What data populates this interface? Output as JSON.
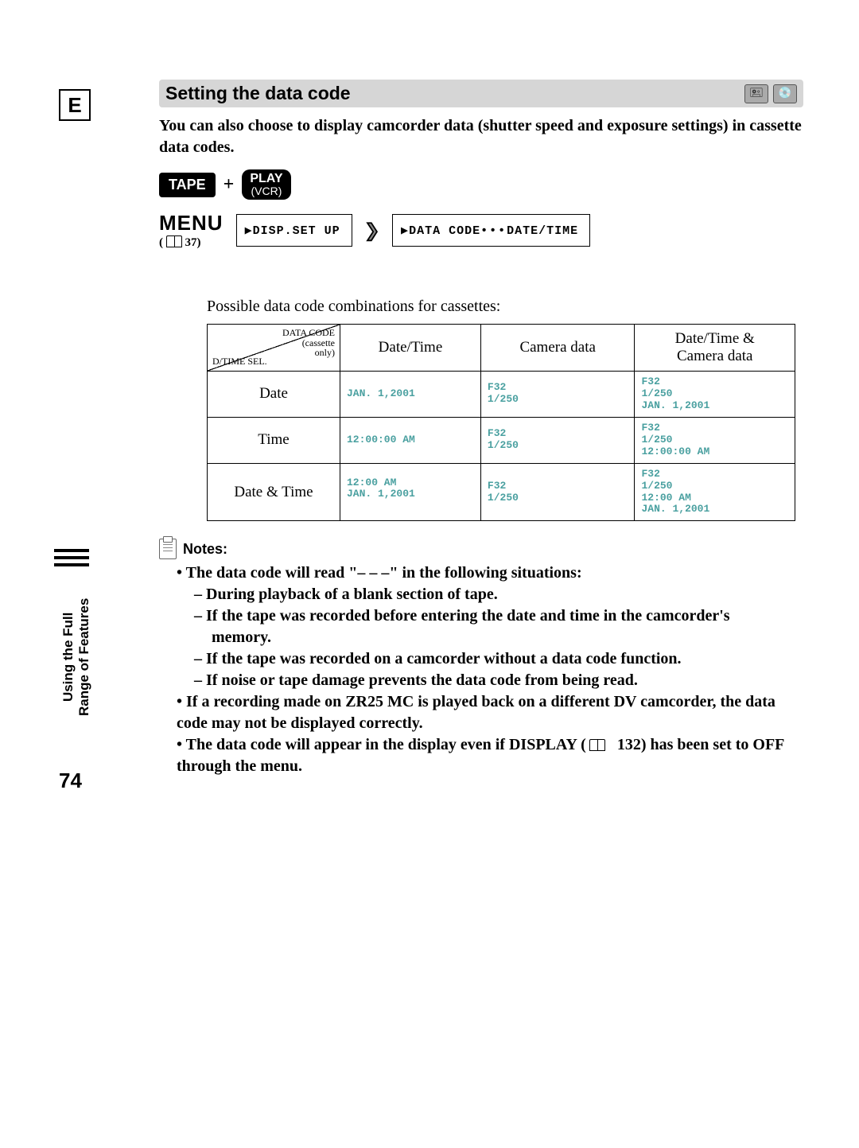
{
  "letter": "E",
  "section_title": "Setting the data code",
  "intro": "You can also choose to display camcorder data (shutter speed and exposure settings) in cassette data codes.",
  "diagram": {
    "tape": "TAPE",
    "plus": "+",
    "play_l1": "PLAY",
    "play_l2": "(VCR)",
    "menu_word": "MENU",
    "menu_ref_num": "37",
    "box1": "▶DISP.SET UP",
    "box2_pre": "▶DATA CODE",
    "box2_dots": "•••",
    "box2_post": "DATE/TIME"
  },
  "table_caption": "Possible data code combinations for cassettes:",
  "table": {
    "corner_top_l1": "DATA CODE",
    "corner_top_l2": "(cassette",
    "corner_top_l3": "only)",
    "corner_bot": "D/TIME SEL.",
    "col1": "Date/Time",
    "col2": "Camera data",
    "col3_l1": "Date/Time &",
    "col3_l2": "Camera data",
    "rows": {
      "r1": {
        "h": "Date",
        "c1": "JAN. 1,2001",
        "c2": "F32\n1/250",
        "c3": "F32\n1/250\nJAN. 1,2001"
      },
      "r2": {
        "h": "Time",
        "c1": "12:00:00 AM",
        "c2": "F32\n1/250",
        "c3": "F32\n1/250\n12:00:00 AM"
      },
      "r3": {
        "h": "Date & Time",
        "c1": "12:00 AM\nJAN. 1,2001",
        "c2": "F32\n1/250",
        "c3": "F32\n1/250\n12:00 AM\nJAN. 1,2001"
      }
    }
  },
  "notes_title": "Notes:",
  "notes": {
    "l1": "The data code will read \"– – –\" in the following situations:",
    "l2": "– During playback of a blank section of tape.",
    "l3": "– If the tape was recorded before entering the date and time in the camcorder's",
    "l3b": "memory.",
    "l4": "– If the tape was recorded on a camcorder without a data code function.",
    "l5": "– If noise or tape damage prevents the data code from being read.",
    "l6": "If a recording made on ZR25 MC is played back on a different DV camcorder, the data code may not be displayed correctly.",
    "l7a": "The data code will appear in the display even if DISPLAY (",
    "l7b": "132) has been set to OFF through the menu."
  },
  "side": {
    "line1": "Using the Full",
    "line2": "Range of Features"
  },
  "page_num": "74",
  "icons": {
    "cassette": "🖭",
    "disc": "💿"
  }
}
